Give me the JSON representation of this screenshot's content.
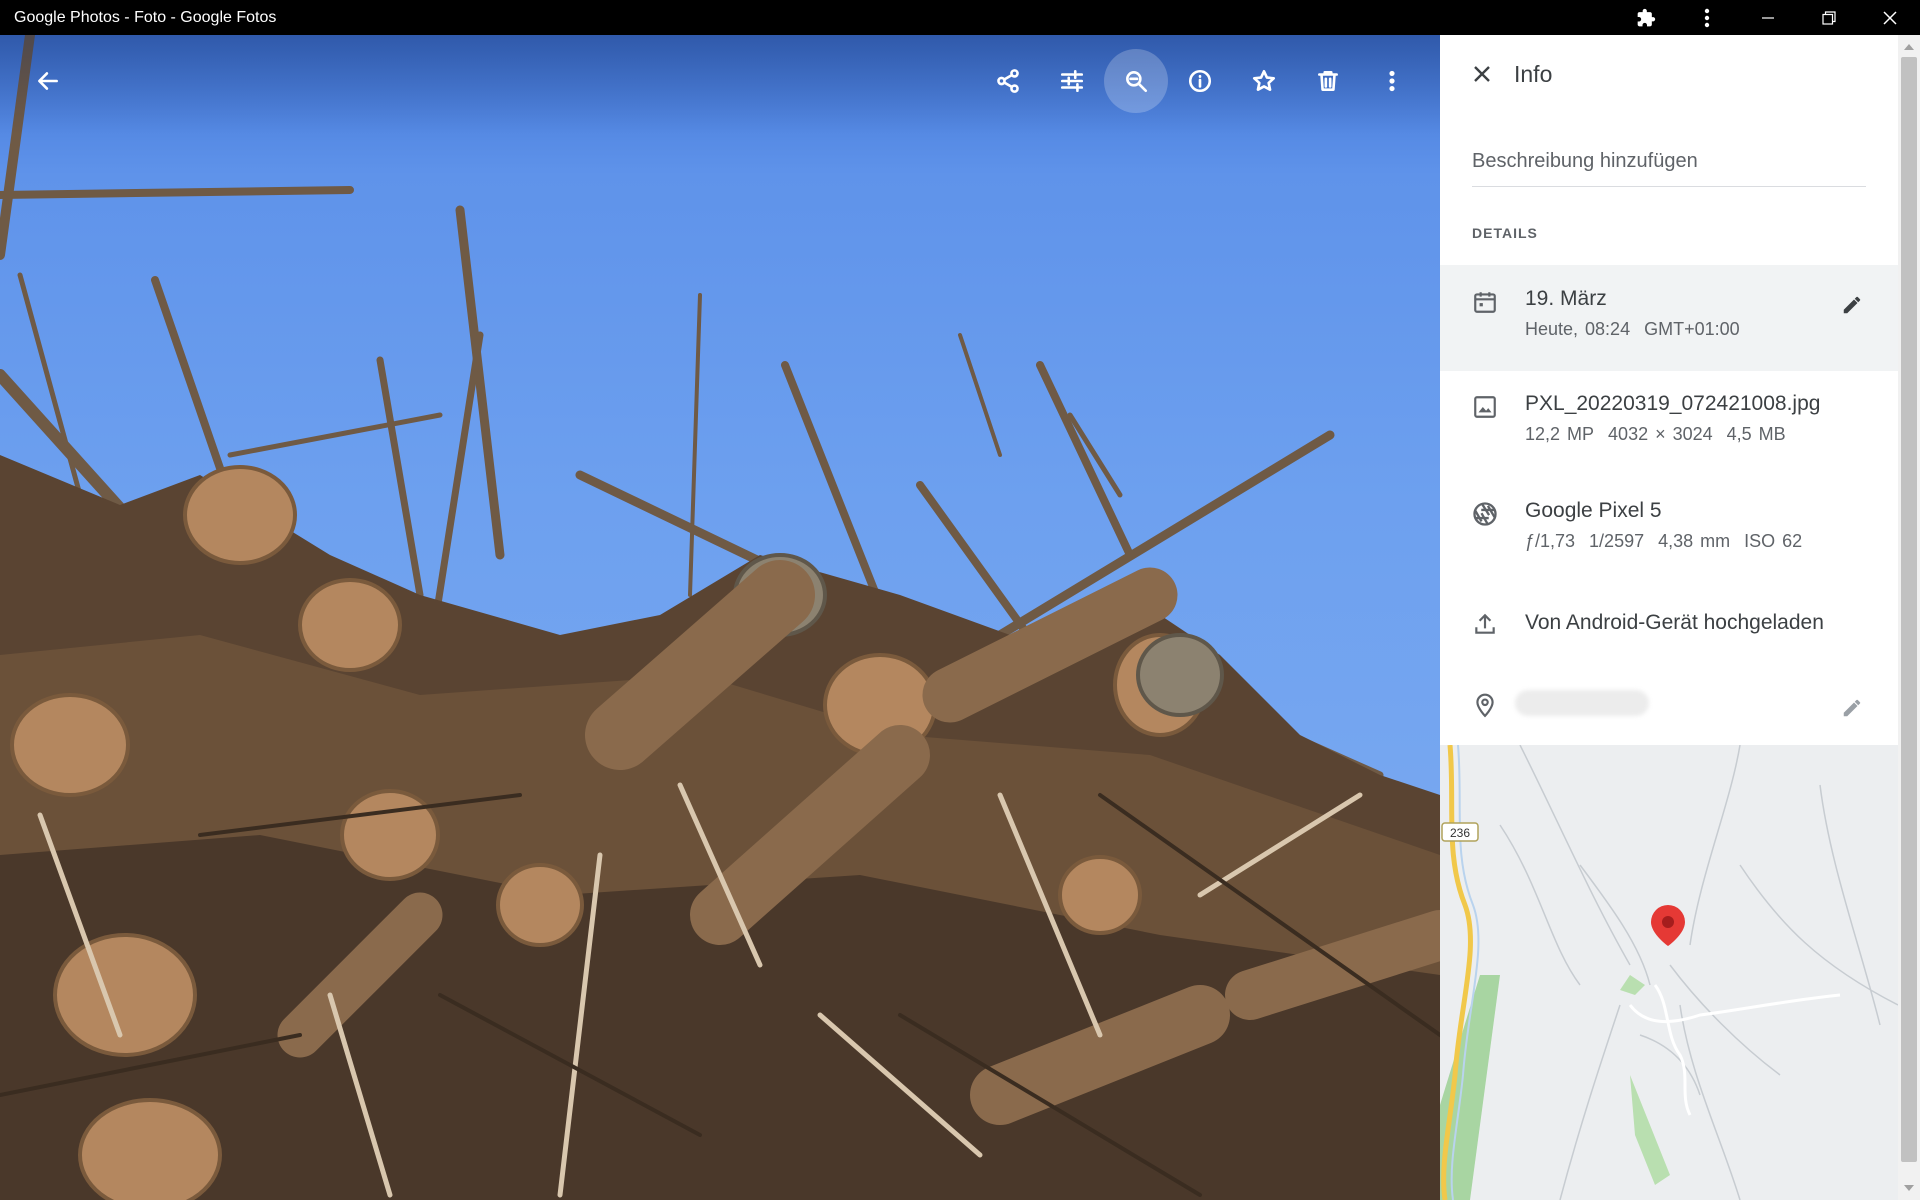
{
  "window": {
    "title": "Google Photos - Foto - Google Fotos"
  },
  "viewer": {
    "toolbar": [
      {
        "name": "share-icon"
      },
      {
        "name": "edit-adjust-icon"
      },
      {
        "name": "zoom-icon",
        "active": true
      },
      {
        "name": "info-icon"
      },
      {
        "name": "star-icon"
      },
      {
        "name": "delete-icon"
      },
      {
        "name": "more-vert-icon"
      }
    ]
  },
  "panel": {
    "title": "Info",
    "description_placeholder": "Beschreibung hinzufügen",
    "details_label": "DETAILS",
    "date": {
      "primary": "19. März",
      "time": "Heute, 08:24",
      "timezone": "GMT+01:00"
    },
    "file": {
      "name": "PXL_20220319_072421008.jpg",
      "megapixels": "12,2 MP",
      "dimensions": "4032 × 3024",
      "size": "4,5 MB"
    },
    "camera": {
      "model": "Google Pixel 5",
      "aperture": "ƒ/1,73",
      "shutter": "1/2597",
      "focal": "4,38 mm",
      "iso": "ISO 62"
    },
    "upload": {
      "text": "Von Android-Gerät hochgeladen"
    },
    "map": {
      "road_label": "236",
      "pin_color": "#e53935"
    }
  }
}
